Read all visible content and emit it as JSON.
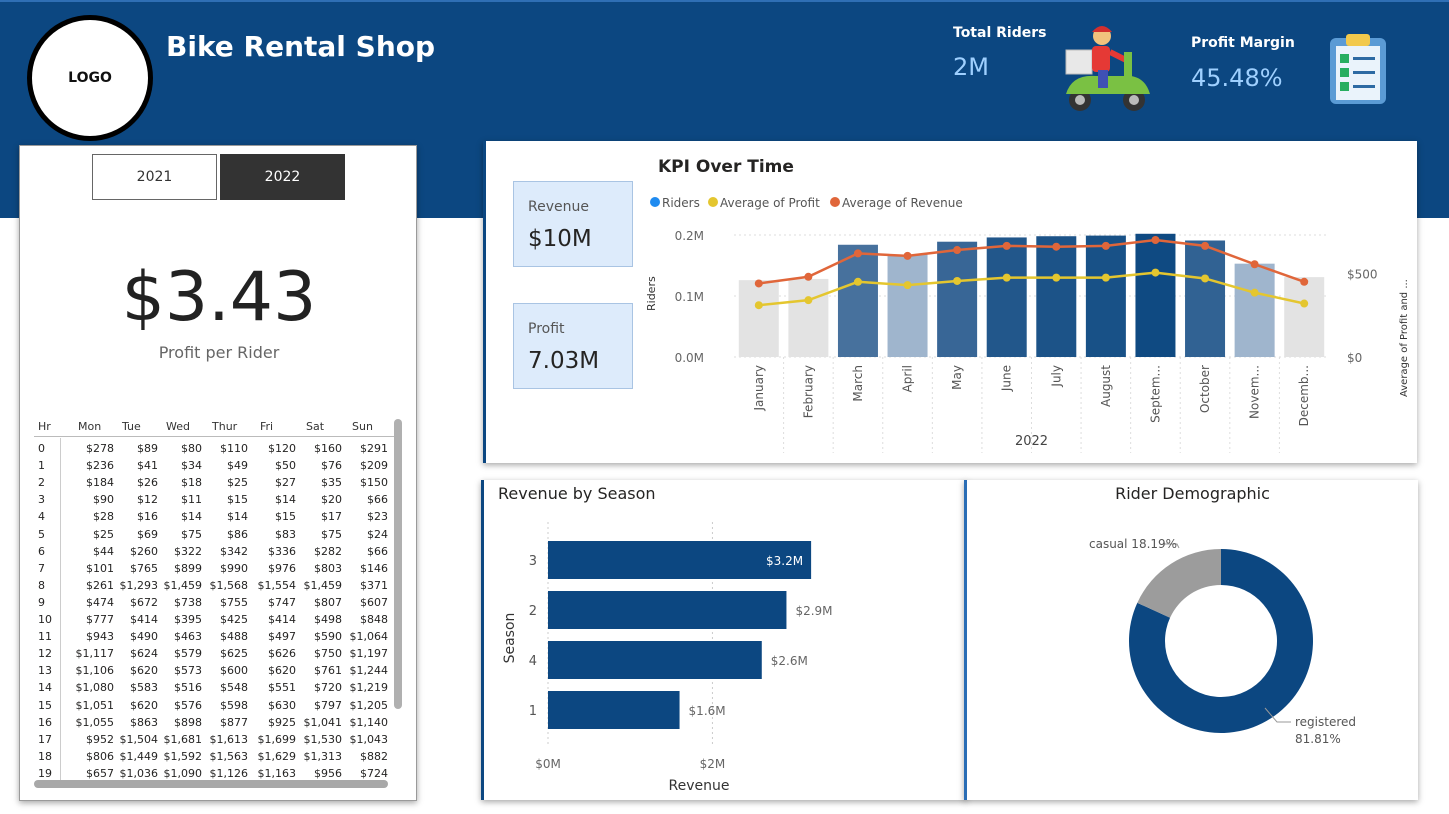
{
  "header": {
    "logo_text": "LOGO",
    "title": "Bike Rental Shop",
    "total_riders_label": "Total Riders",
    "total_riders_value": "2M",
    "profit_margin_label": "Profit Margin",
    "profit_margin_value": "45.48%",
    "scooter_icon": "delivery-scooter-icon",
    "clipboard_icon": "checklist-clipboard-icon"
  },
  "year_slicer": {
    "options": [
      "2021",
      "2022"
    ],
    "selected": "2022"
  },
  "profit_per_rider": {
    "value": "$3.43",
    "label": "Profit per Rider"
  },
  "matrix": {
    "columns": [
      "Hr",
      "Mon",
      "Tue",
      "Wed",
      "Thur",
      "Fri",
      "Sat",
      "Sun"
    ],
    "rows": [
      [
        "0",
        "$278",
        "$89",
        "$80",
        "$110",
        "$120",
        "$160",
        "$291"
      ],
      [
        "1",
        "$236",
        "$41",
        "$34",
        "$49",
        "$50",
        "$76",
        "$209"
      ],
      [
        "2",
        "$184",
        "$26",
        "$18",
        "$25",
        "$27",
        "$35",
        "$150"
      ],
      [
        "3",
        "$90",
        "$12",
        "$11",
        "$15",
        "$14",
        "$20",
        "$66"
      ],
      [
        "4",
        "$28",
        "$16",
        "$14",
        "$14",
        "$15",
        "$17",
        "$23"
      ],
      [
        "5",
        "$25",
        "$69",
        "$75",
        "$86",
        "$83",
        "$75",
        "$24"
      ],
      [
        "6",
        "$44",
        "$260",
        "$322",
        "$342",
        "$336",
        "$282",
        "$66"
      ],
      [
        "7",
        "$101",
        "$765",
        "$899",
        "$990",
        "$976",
        "$803",
        "$146"
      ],
      [
        "8",
        "$261",
        "$1,293",
        "$1,459",
        "$1,568",
        "$1,554",
        "$1,459",
        "$371"
      ],
      [
        "9",
        "$474",
        "$672",
        "$738",
        "$755",
        "$747",
        "$807",
        "$607"
      ],
      [
        "10",
        "$777",
        "$414",
        "$395",
        "$425",
        "$414",
        "$498",
        "$848"
      ],
      [
        "11",
        "$943",
        "$490",
        "$463",
        "$488",
        "$497",
        "$590",
        "$1,064"
      ],
      [
        "12",
        "$1,117",
        "$624",
        "$579",
        "$625",
        "$626",
        "$750",
        "$1,197"
      ],
      [
        "13",
        "$1,106",
        "$620",
        "$573",
        "$600",
        "$620",
        "$761",
        "$1,244"
      ],
      [
        "14",
        "$1,080",
        "$583",
        "$516",
        "$548",
        "$551",
        "$720",
        "$1,219"
      ],
      [
        "15",
        "$1,051",
        "$620",
        "$576",
        "$598",
        "$630",
        "$797",
        "$1,205"
      ],
      [
        "16",
        "$1,055",
        "$863",
        "$898",
        "$877",
        "$925",
        "$1,041",
        "$1,140"
      ],
      [
        "17",
        "$952",
        "$1,504",
        "$1,681",
        "$1,613",
        "$1,699",
        "$1,530",
        "$1,043"
      ],
      [
        "18",
        "$806",
        "$1,449",
        "$1,592",
        "$1,563",
        "$1,629",
        "$1,313",
        "$882"
      ],
      [
        "19",
        "$657",
        "$1,036",
        "$1,090",
        "$1,126",
        "$1,163",
        "$956",
        "$724"
      ]
    ]
  },
  "kpi_cards": [
    {
      "label": "Revenue",
      "value": "$10M"
    },
    {
      "label": "Profit",
      "value": "7.03M"
    }
  ],
  "colors": {
    "header_bg": "#0c4781",
    "bar_light": "#e3e3e3",
    "bar_dark": "#0f4a82",
    "profit_line": "#e4c62f",
    "revenue_line": "#e0663a",
    "riders_legend": "#1f8bf0",
    "season_bar": "#0c4781",
    "donut_registered": "#0c4781",
    "donut_casual": "#9c9c9c"
  },
  "chart_data": [
    {
      "type": "bar",
      "title": "KPI Over Time",
      "legend": [
        "Riders",
        "Average of Profit",
        "Average of Revenue"
      ],
      "categories": [
        "January",
        "February",
        "March",
        "April",
        "May",
        "June",
        "July",
        "August",
        "Septem...",
        "October",
        "Novem...",
        "Decemb..."
      ],
      "xlabel": "2022",
      "ylabel": "Riders",
      "y2label": "Average of Profit and ...",
      "yticks": [
        "0.0M",
        "0.1M",
        "0.2M"
      ],
      "y2ticks": [
        "$0",
        "$500"
      ],
      "ylim": [
        0,
        0.2
      ],
      "y2lim": [
        0,
        730
      ],
      "series": [
        {
          "name": "Riders",
          "values": [
            0.126,
            0.128,
            0.184,
            0.168,
            0.189,
            0.196,
            0.198,
            0.199,
            0.202,
            0.191,
            0.153,
            0.131
          ]
        },
        {
          "name": "Average of Profit",
          "values": [
            310,
            340,
            450,
            430,
            455,
            475,
            475,
            475,
            505,
            470,
            385,
            320
          ]
        },
        {
          "name": "Average of Revenue",
          "values": [
            440,
            480,
            620,
            605,
            640,
            665,
            660,
            665,
            700,
            665,
            555,
            450
          ]
        }
      ]
    },
    {
      "type": "bar",
      "title": "Revenue by Season",
      "categories": [
        "3",
        "2",
        "4",
        "1"
      ],
      "values": [
        3.2,
        2.9,
        2.6,
        1.6
      ],
      "data_labels": [
        "$3.2M",
        "$2.9M",
        "$2.6M",
        "$1.6M"
      ],
      "xlabel": "Revenue",
      "ylabel": "Season",
      "xticks": [
        "$0M",
        "$2M"
      ],
      "xlim": [
        0,
        3.9
      ]
    },
    {
      "type": "pie",
      "title": "Rider Demographic",
      "labels": [
        "registered",
        "casual"
      ],
      "values": [
        81.81,
        18.19
      ],
      "data_labels": [
        "81.81%",
        "18.19%"
      ]
    }
  ]
}
